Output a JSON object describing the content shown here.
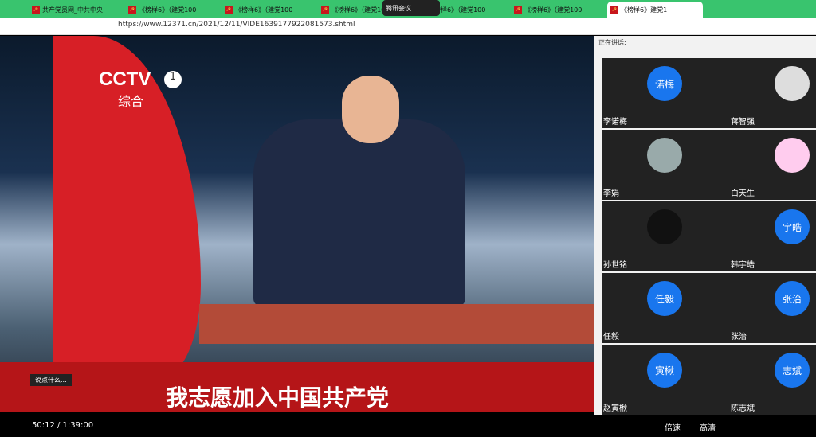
{
  "tabs": [
    {
      "label": "共产党员网_中共中央"
    },
    {
      "label": "《榜样6》（建党100"
    },
    {
      "label": "《榜样6》（建党100"
    },
    {
      "label": "《榜样6》（建党100"
    },
    {
      "label": "《榜样6》（建党100"
    },
    {
      "label": "《榜样6》（建党100"
    },
    {
      "label": "《榜样6》（建党100"
    },
    {
      "label": "《榜样6》（建党100"
    },
    {
      "label": "《榜样6》建党1"
    }
  ],
  "meeting_badge": "腾讯会议",
  "address": {
    "url": "https://www.12371.cn/2021/12/11/VIDE1639177922081573.shtml"
  },
  "video": {
    "logo": "CCTV",
    "channel": "1",
    "channel_name": "综合",
    "subtitle": "我志愿加入中国共产党"
  },
  "controls": {
    "time": "50:12 / 1:39:00",
    "comment_placeholder": "说点什么...",
    "speed": "倍速",
    "quality": "高清"
  },
  "panel": {
    "speaking_label": "正在讲话:",
    "participants": [
      {
        "avatar_text": "诺梅",
        "name": "李诺梅"
      },
      {
        "avatar_text": "",
        "name": "蒋智强"
      },
      {
        "avatar_text": "",
        "name": "李娟"
      },
      {
        "avatar_text": "",
        "name": "白天生"
      },
      {
        "avatar_text": "",
        "name": "孙世铭"
      },
      {
        "avatar_text": "宇皓",
        "name": "韩宇皓"
      },
      {
        "avatar_text": "任毅",
        "name": "任毅"
      },
      {
        "avatar_text": "张治",
        "name": "张治"
      },
      {
        "avatar_text": "寅楸",
        "name": "赵寅楸"
      },
      {
        "avatar_text": "志斌",
        "name": "陈志斌"
      }
    ]
  }
}
